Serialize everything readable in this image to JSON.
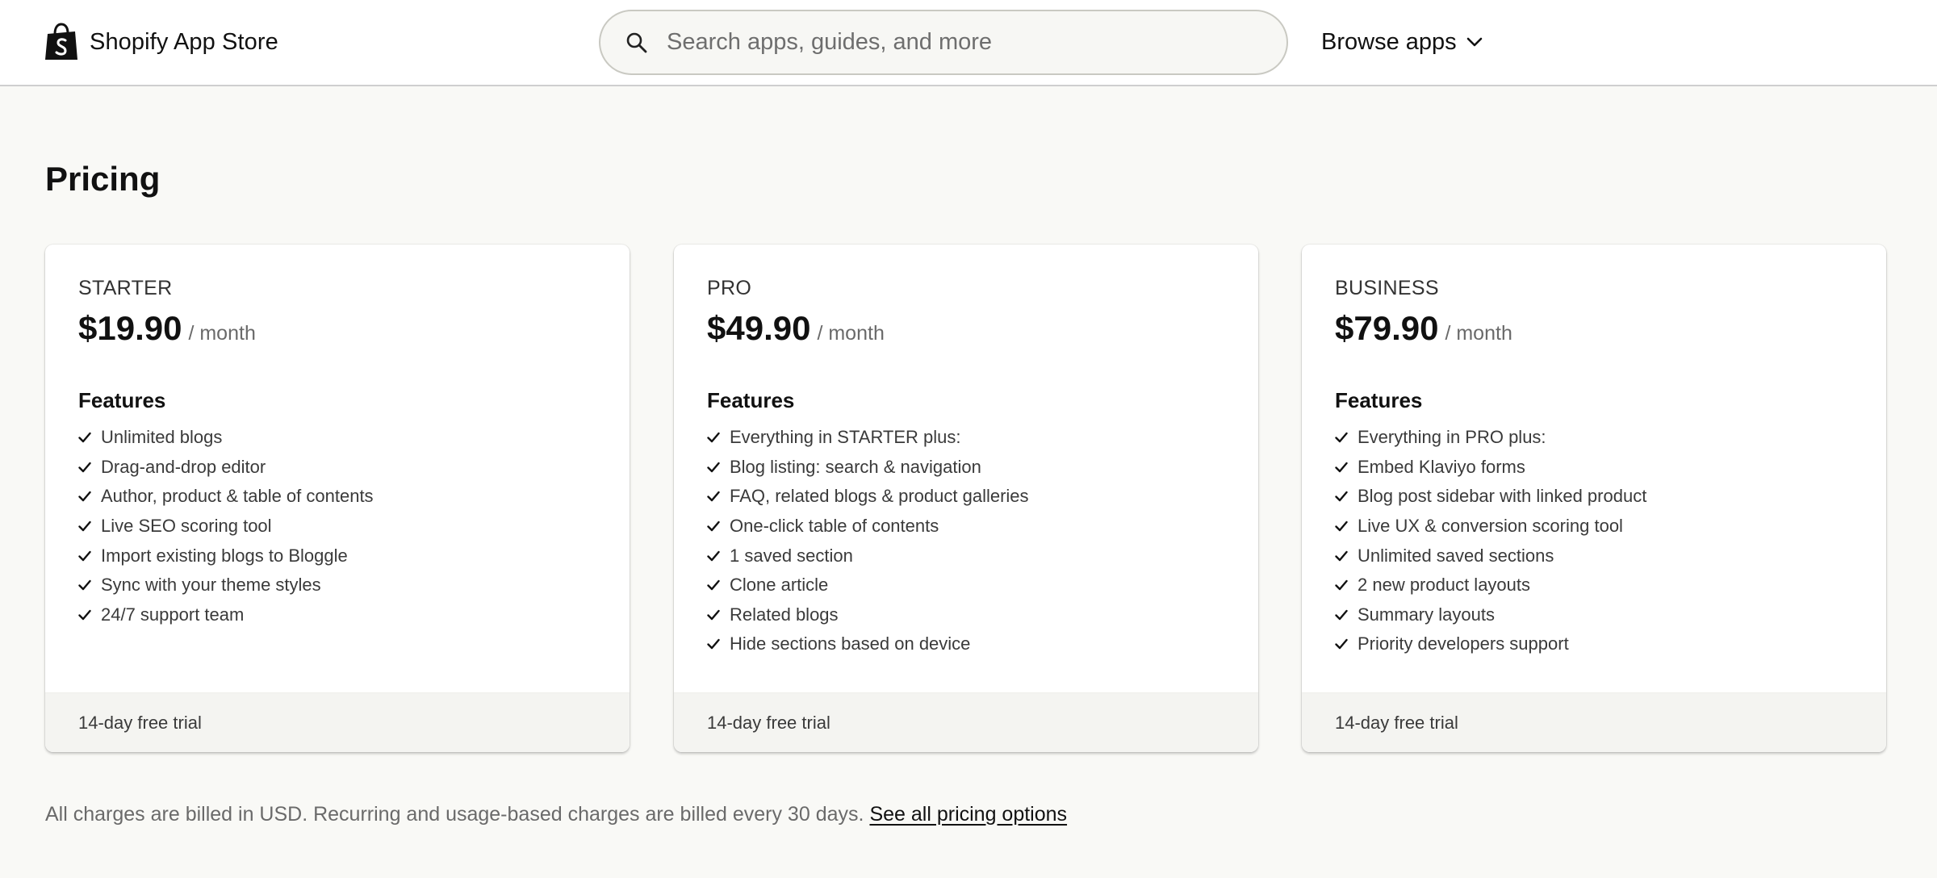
{
  "header": {
    "brand": "Shopify App Store",
    "search_placeholder": "Search apps, guides, and more",
    "browse_label": "Browse apps"
  },
  "page": {
    "title": "Pricing"
  },
  "plans": [
    {
      "name": "STARTER",
      "price": "$19.90",
      "period": "/ month",
      "features_title": "Features",
      "features": [
        "Unlimited blogs",
        "Drag-and-drop editor",
        "Author, product & table of contents",
        "Live SEO scoring tool",
        "Import existing blogs to Bloggle",
        "Sync with your theme styles",
        "24/7 support team"
      ],
      "trial": "14-day free trial"
    },
    {
      "name": "PRO",
      "price": "$49.90",
      "period": "/ month",
      "features_title": "Features",
      "features": [
        "Everything in STARTER plus:",
        "Blog listing: search & navigation",
        "FAQ, related blogs & product galleries",
        "One-click table of contents",
        "1 saved section",
        "Clone article",
        "Related blogs",
        "Hide sections based on device"
      ],
      "trial": "14-day free trial"
    },
    {
      "name": "BUSINESS",
      "price": "$79.90",
      "period": "/ month",
      "features_title": "Features",
      "features": [
        "Everything in PRO plus:",
        "Embed Klaviyo forms",
        "Blog post sidebar with linked product",
        "Live UX & conversion scoring tool",
        "Unlimited saved sections",
        "2 new product layouts",
        "Summary layouts",
        "Priority developers support"
      ],
      "trial": "14-day free trial"
    }
  ],
  "footer_note": {
    "text": "All charges are billed in USD. Recurring and usage-based charges are billed every 30 days.",
    "link": "See all pricing options"
  },
  "icons": {
    "brand_logo": "shopify-bag-icon",
    "search": "search-icon",
    "browse_chevron": "chevron-down-icon",
    "feature_check": "check-icon"
  },
  "colors": {
    "page_background": "#f9f9f6",
    "card_background": "#ffffff",
    "card_footer_background": "#f4f4f1",
    "text_primary": "#111111",
    "text_secondary": "#6a6a6a"
  }
}
